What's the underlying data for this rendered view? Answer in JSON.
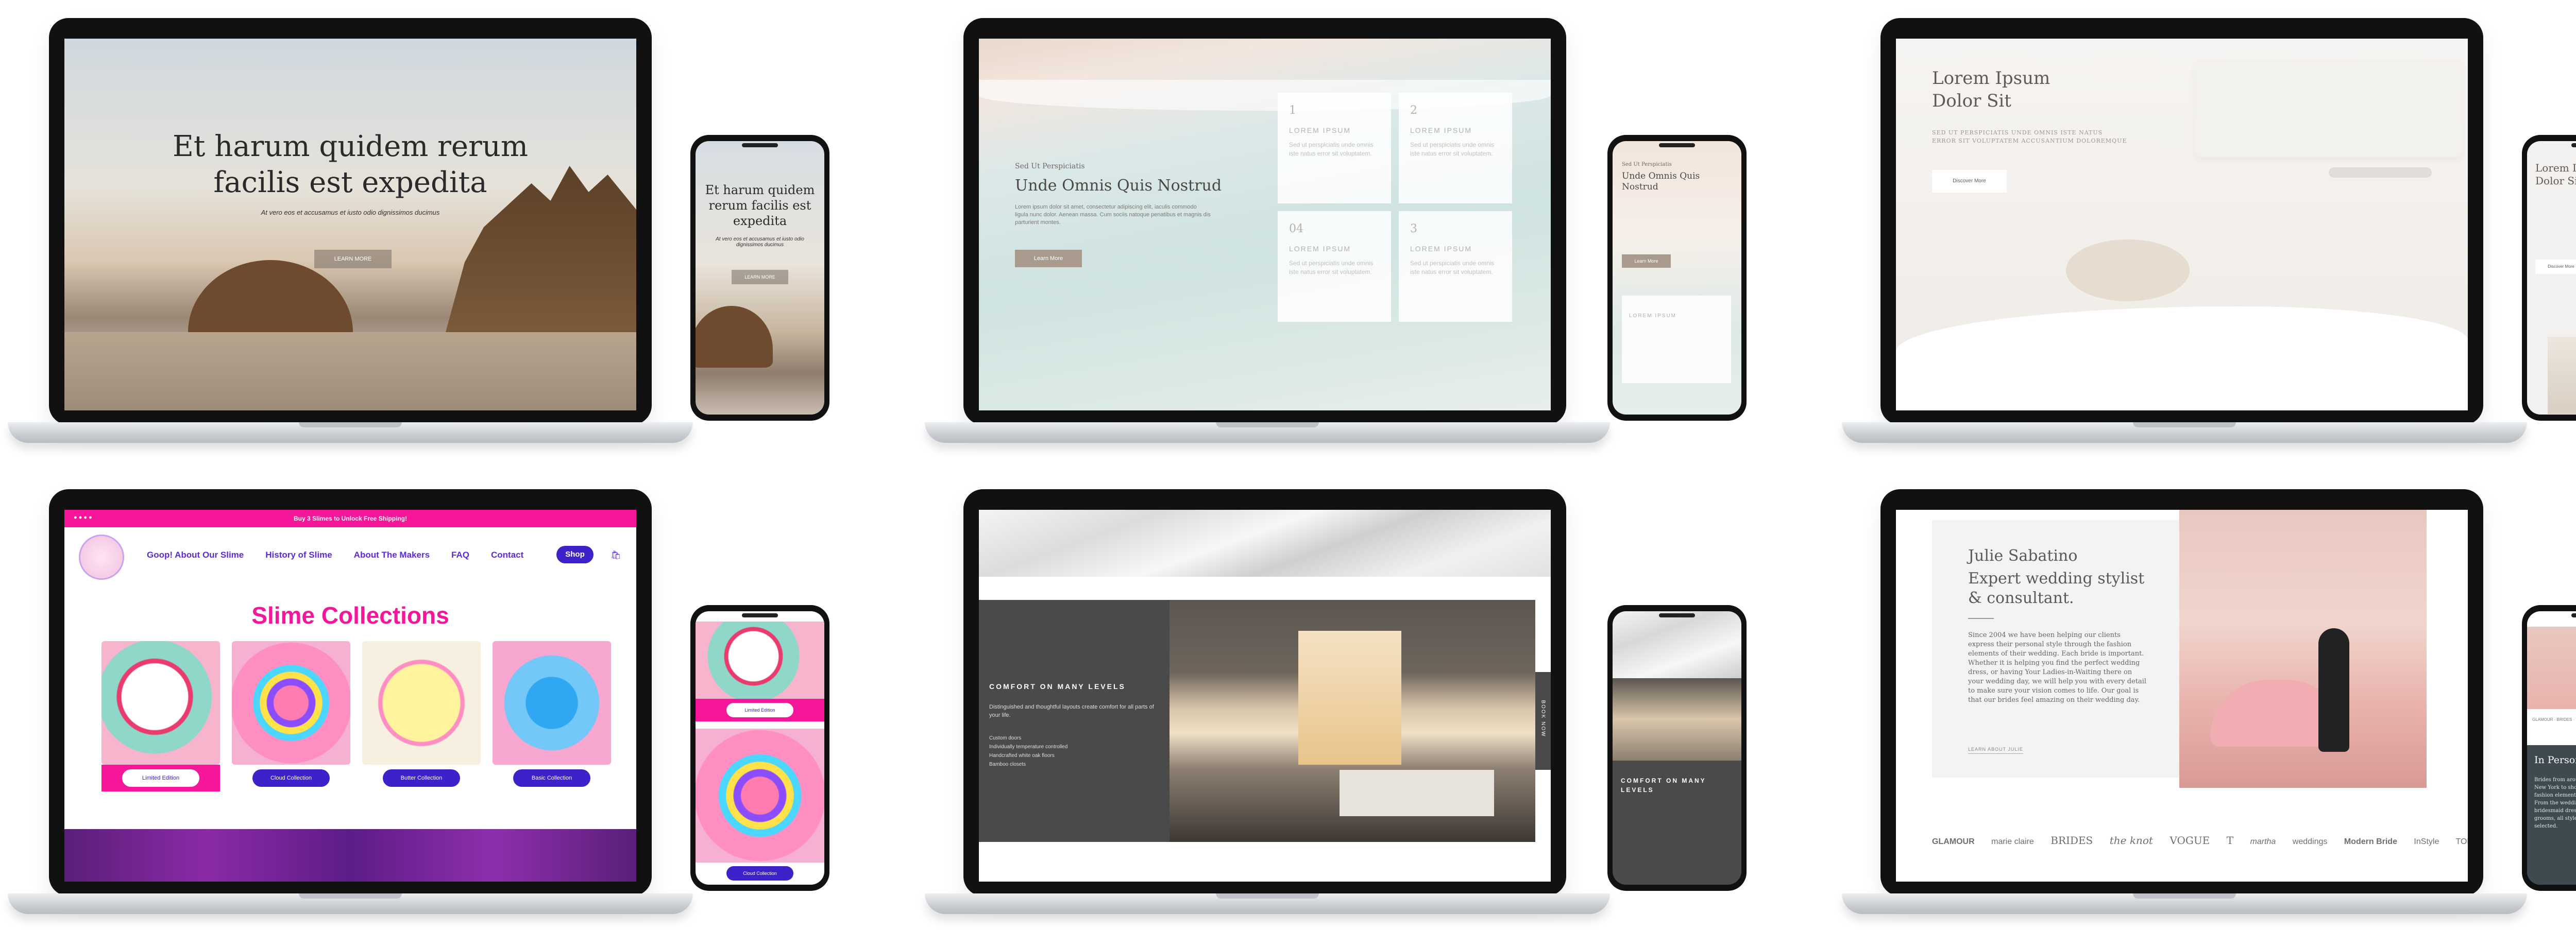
{
  "mockup1": {
    "heading": "Et harum quidem rerum facilis est expedita",
    "subtext": "At vero eos et accusamus et iusto odio dignissimos ducimus",
    "button": "LEARN MORE",
    "phone_heading": "Et harum quidem rerum facilis est expedita",
    "phone_subtext": "At vero eos et accusamus et iusto odio dignissimos ducimus",
    "phone_button": "LEARN MORE"
  },
  "mockup2": {
    "eyebrow": "Sed Ut Perspiciatis",
    "heading": "Unde Omnis Quis Nostrud",
    "body": "Lorem ipsum dolor sit amet, consectetur adipiscing elit, iaculis commodo ligula nunc dolor. Aenean massa. Cum sociis natoque penatibus et magnis dis parturient montes.",
    "button": "Learn More",
    "cards": [
      {
        "icon": "1",
        "title": "LOREM IPSUM",
        "text": "Sed ut perspiciatis unde omnis iste natus error sit voluptatem."
      },
      {
        "icon": "2",
        "title": "LOREM IPSUM",
        "text": "Sed ut perspiciatis unde omnis iste natus error sit voluptatem."
      },
      {
        "icon": "04",
        "title": "LOREM IPSUM",
        "text": "Sed ut perspiciatis unde omnis iste natus error sit voluptatem."
      },
      {
        "icon": "3",
        "title": "LOREM IPSUM",
        "text": "Sed ut perspiciatis unde omnis iste natus error sit voluptatem."
      }
    ],
    "phone_eyebrow": "Sed Ut Perspiciatis",
    "phone_heading": "Unde Omnis Quis Nostrud",
    "phone_button": "Learn More",
    "phone_card_title": "LOREM IPSUM"
  },
  "mockup3": {
    "heading": "Lorem Ipsum Dolor Sit",
    "subtext": "SED UT PERSPICIATIS UNDE OMNIS ISTE NATUS ERROR SIT VOLUPTATEM ACCUSANTIUM DOLOREMQUE",
    "button": "Discover More",
    "phone_heading": "Lorem Ipsum Dolor Sit",
    "phone_button": "Discover More"
  },
  "mockup4": {
    "banner": "Buy 3 Slimes to Unlock Free Shipping!",
    "nav": [
      "Goop! About Our Slime",
      "History of Slime",
      "About The Makers",
      "FAQ",
      "Contact"
    ],
    "shop": "Shop",
    "title": "Slime Collections",
    "collections": [
      "Limited Edition",
      "Cloud Collection",
      "Butter Collection",
      "Basic Collection"
    ],
    "phone_button_1": "Limited Edition",
    "phone_button_2": "Cloud Collection",
    "colors": {
      "pink": "#f5169a",
      "purple": "#3b22c9"
    }
  },
  "mockup5": {
    "heading": "COMFORT ON MANY LEVELS",
    "body": "Distinguished and thoughtful layouts create comfort for all parts of your life.",
    "list": [
      "Custom doors",
      "Individually temperature controlled",
      "Handcrafted white oak floors",
      "Bamboo closets"
    ],
    "side_tab": "BOOK NOW",
    "phone_heading": "COMFORT ON MANY LEVELS"
  },
  "mockup6": {
    "name": "Julie Sabatino",
    "heading": "Expert wedding stylist & consultant.",
    "body": "Since 2004 we have been helping our clients express their personal style through the fashion elements of their wedding. Each bride is important. Whether it is helping you find the perfect wedding dress, or having Your Ladies-in-Waiting there on your wedding day, we will help you with every detail to make sure your vision comes to life. Our goal is that our brides feel amazing on their wedding day.",
    "link": "LEARN ABOUT JULIE",
    "logos": [
      "GLAMOUR",
      "marie claire",
      "BRIDES",
      "the knot",
      "VOGUE",
      "T",
      "martha",
      "weddings",
      "Modern Bride",
      "InStyle",
      "TODAY"
    ],
    "phone_section": "In Person Styling",
    "phone_body": "Brides from around the world come to New York to shop with us for all of the fashion elements of their wedding. From the wedding dress and bridesmaid dresses, to mothers and grooms, all styles are carefully selected."
  }
}
